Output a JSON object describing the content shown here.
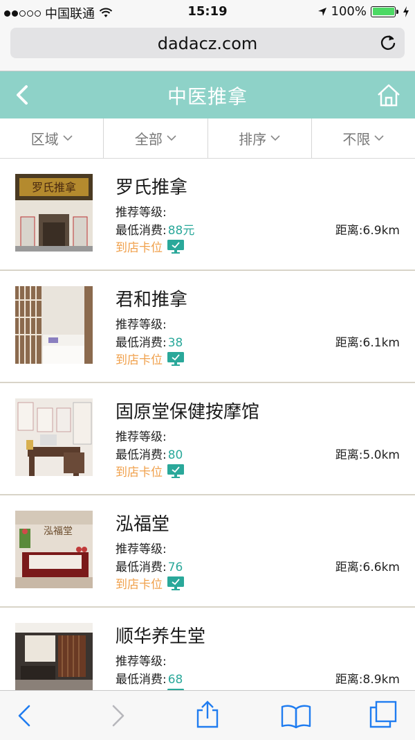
{
  "status_bar": {
    "carrier": "中国联通",
    "time": "15:19",
    "battery": "100%",
    "signal_filled": 2,
    "signal_total": 5
  },
  "browser": {
    "url": "dadacz.com"
  },
  "header": {
    "title": "中医推拿"
  },
  "filters": [
    "区域",
    "全部",
    "排序",
    "不限"
  ],
  "labels": {
    "rank": "推荐等级:",
    "price": "最低消费:",
    "booking": "到店卡位",
    "distance": "距离:"
  },
  "items": [
    {
      "name": "罗氏推拿",
      "price": "88元",
      "distance": "6.9km",
      "sign_text": "罗氏推拿"
    },
    {
      "name": "君和推拿",
      "price": "38",
      "distance": "6.1km"
    },
    {
      "name": "固原堂保健按摩馆",
      "price": "80",
      "distance": "5.0km"
    },
    {
      "name": "泓福堂",
      "price": "76",
      "distance": "6.6km",
      "sign_text": "泓福堂"
    },
    {
      "name": "顺华养生堂",
      "price": "68",
      "distance": "8.9km"
    }
  ],
  "colors": {
    "header_bg": "#8ed2c8",
    "price": "#2aa89a",
    "booking": "#f0a04b",
    "ios_blue": "#1f7cf0",
    "battery": "#4cd964"
  },
  "icons": [
    "back-arrow-icon",
    "home-icon",
    "chevron-down-icon",
    "screen-icon",
    "reload-icon",
    "share-icon",
    "bookmarks-icon",
    "tabs-icon"
  ]
}
